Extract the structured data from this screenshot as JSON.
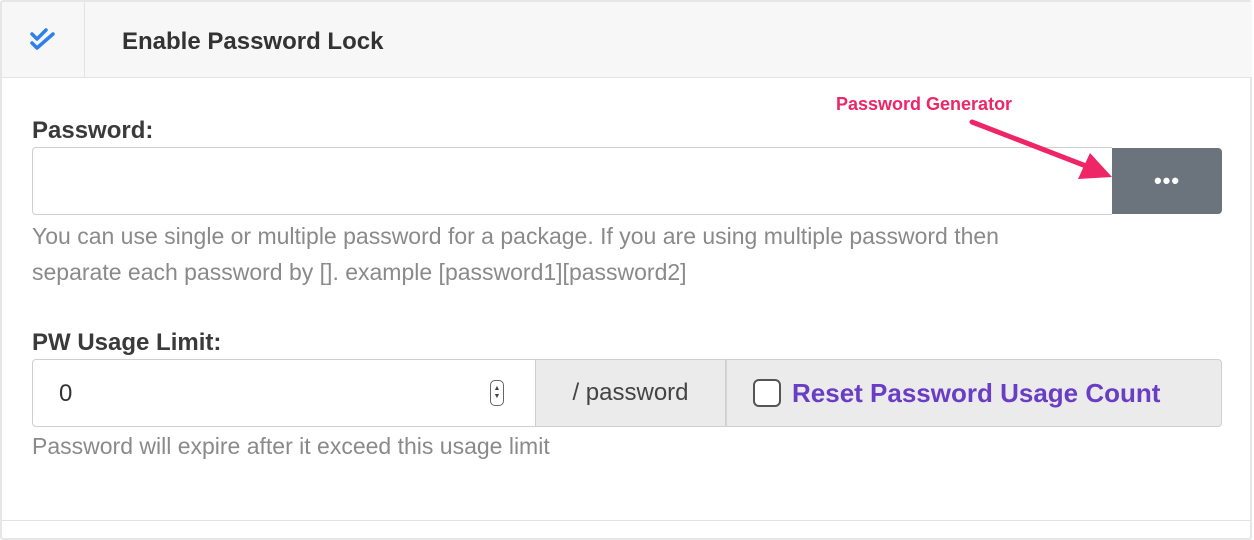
{
  "header": {
    "title": "Enable Password Lock",
    "icon": "double-check-icon",
    "accent_color": "#2f80ed"
  },
  "password": {
    "label": "Password:",
    "value": "",
    "generator_button_label": "•••",
    "help": [
      "You can use single or multiple password for a package. If you are using multiple password then",
      "separate each password by []. example [password1][password2]"
    ]
  },
  "usage_limit": {
    "label": "PW Usage Limit:",
    "value": "0",
    "unit": "/ password",
    "reset_label": "Reset Password Usage Count",
    "reset_checked": false,
    "help": "Password will expire after it exceed this usage limit"
  },
  "annotation": {
    "text": "Password Generator",
    "color": "#ee2566"
  }
}
